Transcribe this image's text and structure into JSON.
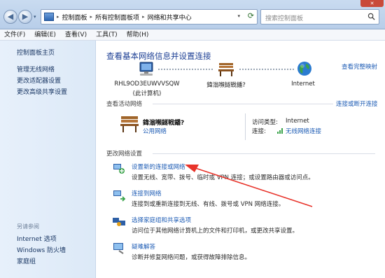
{
  "window": {
    "close_glyph": "✕"
  },
  "breadcrumbs": [
    "控制面板",
    "所有控制面板项",
    "网络和共享中心"
  ],
  "search": {
    "placeholder": "搜索控制面板"
  },
  "menu": [
    "文件(F)",
    "编辑(E)",
    "查看(V)",
    "工具(T)",
    "帮助(H)"
  ],
  "sidebar": {
    "links": [
      "控制面板主页",
      "管理无线网络",
      "更改适配器设置",
      "更改高级共享设置"
    ],
    "see_also_heading": "另请参阅",
    "see_also": [
      "Internet 选项",
      "Windows 防火墙",
      "家庭组"
    ]
  },
  "main": {
    "title": "查看基本网络信息并设置连接",
    "full_map_link": "查看完整映射",
    "map": {
      "computer_name": "RHL9OD3EUWVVSQW",
      "computer_note": "(此计算机)",
      "network_name": "鍏滃嚬鐩戦鐇?",
      "internet": "Internet"
    },
    "active_networks_label": "查看活动网络",
    "connect_or_disconnect": "连接或断开连接",
    "active_network": {
      "name": "鍏滃嚬鐩戦鐇?",
      "type": "公用网络",
      "access_type_label": "访问类型:",
      "access_type_value": "Internet",
      "connections_label": "连接:",
      "connections_value": "无线网络连接"
    },
    "change_settings_label": "更改网络设置",
    "tasks": [
      {
        "title": "设置新的连接或网络",
        "desc": "设置无线、宽带、拨号、临时或 VPN 连接；或设置路由器或访问点。"
      },
      {
        "title": "连接到网络",
        "desc": "连接到或重新连接到无线、有线、拨号或 VPN 网络连接。"
      },
      {
        "title": "选择家庭组和共享选项",
        "desc": "访问位于其他网络计算机上的文件和打印机，或更改共享设置。"
      },
      {
        "title": "疑难解答",
        "desc": "诊断并修复网络问题，或获得故障排除信息。"
      }
    ]
  },
  "colors": {
    "link": "#1c5bb4",
    "title": "#1c3f94",
    "arrow": "#e8332a",
    "sidebar_bg": "#dce9f7"
  }
}
